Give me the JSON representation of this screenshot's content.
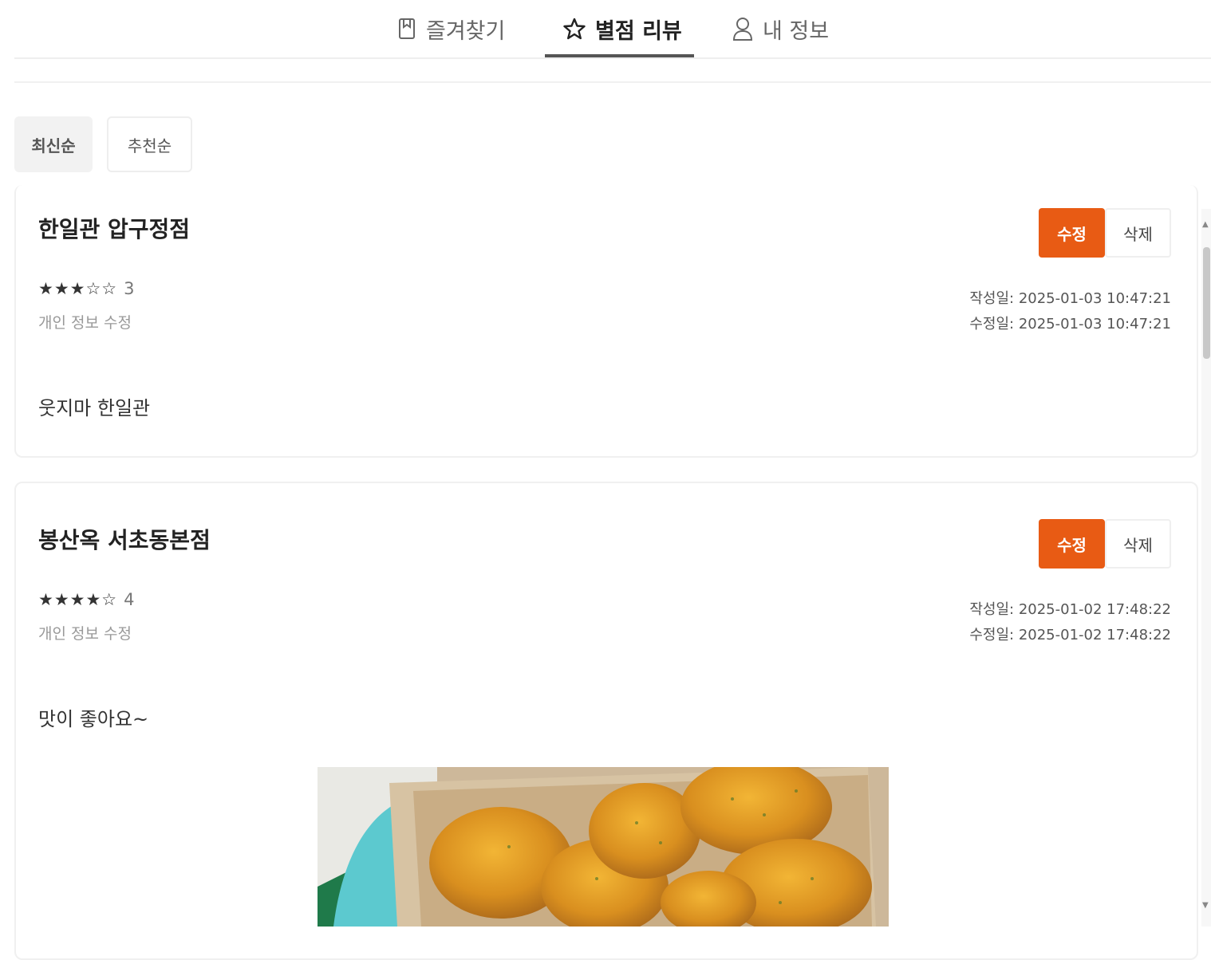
{
  "tabs": [
    {
      "label": "즐겨찾기",
      "icon": "bookmark-icon",
      "active": false
    },
    {
      "label": "별점 리뷰",
      "icon": "star-icon",
      "active": true
    },
    {
      "label": "내 정보",
      "icon": "user-icon",
      "active": false
    }
  ],
  "sort": {
    "latest_label": "최신순",
    "recommend_label": "추천순",
    "selected": "최신순"
  },
  "reviews": [
    {
      "store": "한일관 압구정점",
      "stars_display": "★★★☆☆",
      "rating": "3",
      "edit_info": "개인 정보 수정",
      "created": "작성일: 2025-01-03 10:47:21",
      "modified": "수정일: 2025-01-03 10:47:21",
      "content": "웃지마 한일관",
      "edit_label": "수정",
      "delete_label": "삭제"
    },
    {
      "store": "봉산옥 서초동본점",
      "stars_display": "★★★★☆",
      "rating": "4",
      "edit_info": "개인 정보 수정",
      "created": "작성일: 2025-01-02 17:48:22",
      "modified": "수정일: 2025-01-02 17:48:22",
      "content": "맛이 좋아요~",
      "edit_label": "수정",
      "delete_label": "삭제"
    }
  ],
  "colors": {
    "accent": "#e85b14",
    "tab_underline": "#555555"
  }
}
